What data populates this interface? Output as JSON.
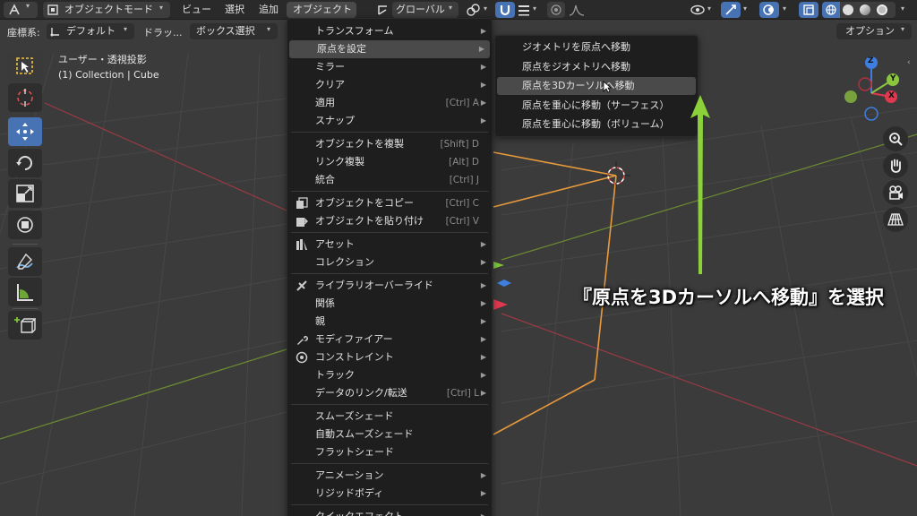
{
  "header": {
    "mode": "オブジェクトモード",
    "menus": [
      "ビュー",
      "選択",
      "追加",
      "オブジェクト"
    ],
    "orientation": "グローバル"
  },
  "header2": {
    "coord_label": "座標系:",
    "coord_value": "デフォルト",
    "drag_label": "ドラッ...",
    "box_select": "ボックス選択",
    "options": "オプション"
  },
  "viewport_info": {
    "line1": "ユーザー・透視投影",
    "line2": "(1) Collection | Cube"
  },
  "object_menu": {
    "items": [
      {
        "label": "トランスフォーム",
        "shortcut": "",
        "submenu": true
      },
      {
        "label": "原点を設定",
        "shortcut": "",
        "submenu": true
      },
      {
        "label": "ミラー",
        "shortcut": "",
        "submenu": true
      },
      {
        "label": "クリア",
        "shortcut": "",
        "submenu": true
      },
      {
        "label": "適用",
        "shortcut": "[Ctrl] A",
        "submenu": true
      },
      {
        "label": "スナップ",
        "shortcut": "",
        "submenu": true
      },
      {
        "label": "オブジェクトを複製",
        "shortcut": "[Shift] D",
        "submenu": false
      },
      {
        "label": "リンク複製",
        "shortcut": "[Alt] D",
        "submenu": false
      },
      {
        "label": "統合",
        "shortcut": "[Ctrl] J",
        "submenu": false
      },
      {
        "label": "オブジェクトをコピー",
        "shortcut": "[Ctrl] C",
        "submenu": false
      },
      {
        "label": "オブジェクトを貼り付け",
        "shortcut": "[Ctrl] V",
        "submenu": false
      },
      {
        "label": "アセット",
        "shortcut": "",
        "submenu": true
      },
      {
        "label": "コレクション",
        "shortcut": "",
        "submenu": true
      },
      {
        "label": "ライブラリオーバーライド",
        "shortcut": "",
        "submenu": true
      },
      {
        "label": "関係",
        "shortcut": "",
        "submenu": true
      },
      {
        "label": "親",
        "shortcut": "",
        "submenu": true
      },
      {
        "label": "モディファイアー",
        "shortcut": "",
        "submenu": true
      },
      {
        "label": "コンストレイント",
        "shortcut": "",
        "submenu": true
      },
      {
        "label": "トラック",
        "shortcut": "",
        "submenu": true
      },
      {
        "label": "データのリンク/転送",
        "shortcut": "[Ctrl] L",
        "submenu": true
      },
      {
        "label": "スムーズシェード",
        "shortcut": "",
        "submenu": false
      },
      {
        "label": "自動スムーズシェード",
        "shortcut": "",
        "submenu": false
      },
      {
        "label": "フラットシェード",
        "shortcut": "",
        "submenu": false
      },
      {
        "label": "アニメーション",
        "shortcut": "",
        "submenu": true
      },
      {
        "label": "リジッドボディ",
        "shortcut": "",
        "submenu": true
      },
      {
        "label": "クイックエフェクト",
        "shortcut": "",
        "submenu": true
      }
    ]
  },
  "origin_submenu": {
    "items": [
      "ジオメトリを原点へ移動",
      "原点をジオメトリへ移動",
      "原点を3Dカーソルへ移動",
      "原点を重心に移動（サーフェス）",
      "原点を重心に移動（ボリューム）"
    ],
    "highlighted_index": 2
  },
  "annotation": {
    "text": "『原点を3Dカーソルへ移動』を選択",
    "arrow_color": "#8bd13a"
  },
  "gizmo": {
    "x": "X",
    "y": "Y",
    "z": "Z"
  },
  "colors": {
    "accent_blue": "#4772b3",
    "x_red": "#e0384f",
    "y_green": "#8cc63f",
    "z_blue": "#3d7ee0",
    "cube_orange": "#e89a3c"
  }
}
